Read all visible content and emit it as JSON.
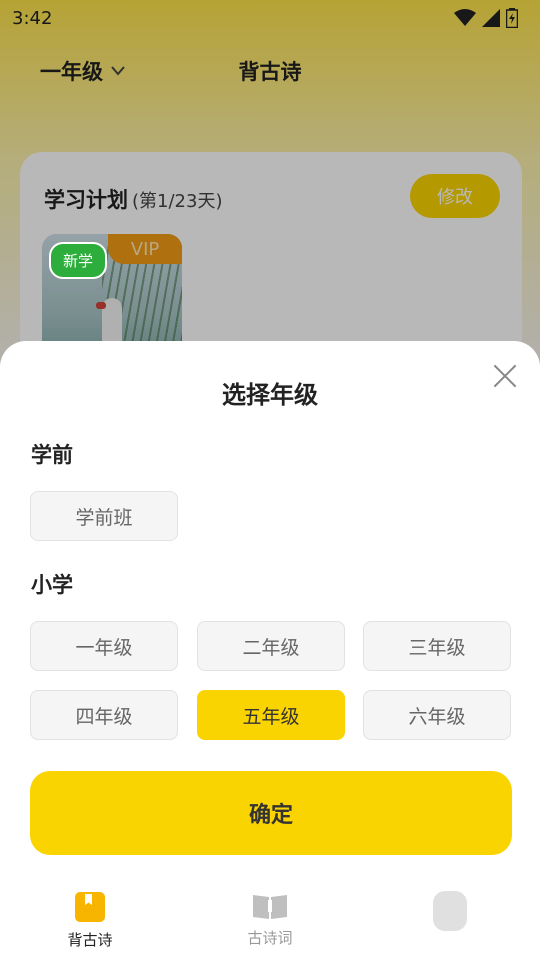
{
  "status_bar": {
    "time": "3:42"
  },
  "header": {
    "grade_select": "一年级",
    "title": "背古诗"
  },
  "plan_card": {
    "title": "学习计划",
    "progress": "(第1/23天)",
    "edit_label": "修改",
    "badge_new": "新学",
    "badge_vip": "VIP"
  },
  "sheet": {
    "title": "选择年级",
    "sections": [
      {
        "heading": "学前",
        "options": [
          "学前班"
        ]
      },
      {
        "heading": "小学",
        "options": [
          "一年级",
          "二年级",
          "三年级",
          "四年级",
          "五年级",
          "六年级"
        ]
      }
    ],
    "selected": "五年级",
    "confirm_label": "确定"
  },
  "bottom_nav": {
    "items": [
      {
        "label": "背古诗",
        "icon": "bookmark-book-icon",
        "active": true
      },
      {
        "label": "古诗词",
        "icon": "open-book-icon",
        "active": false
      },
      {
        "label": "",
        "icon": "profile-icon",
        "active": false
      }
    ]
  },
  "colors": {
    "accent": "#FAD400",
    "badge_green": "#2DAE3C",
    "badge_orange": "#F39B17"
  }
}
